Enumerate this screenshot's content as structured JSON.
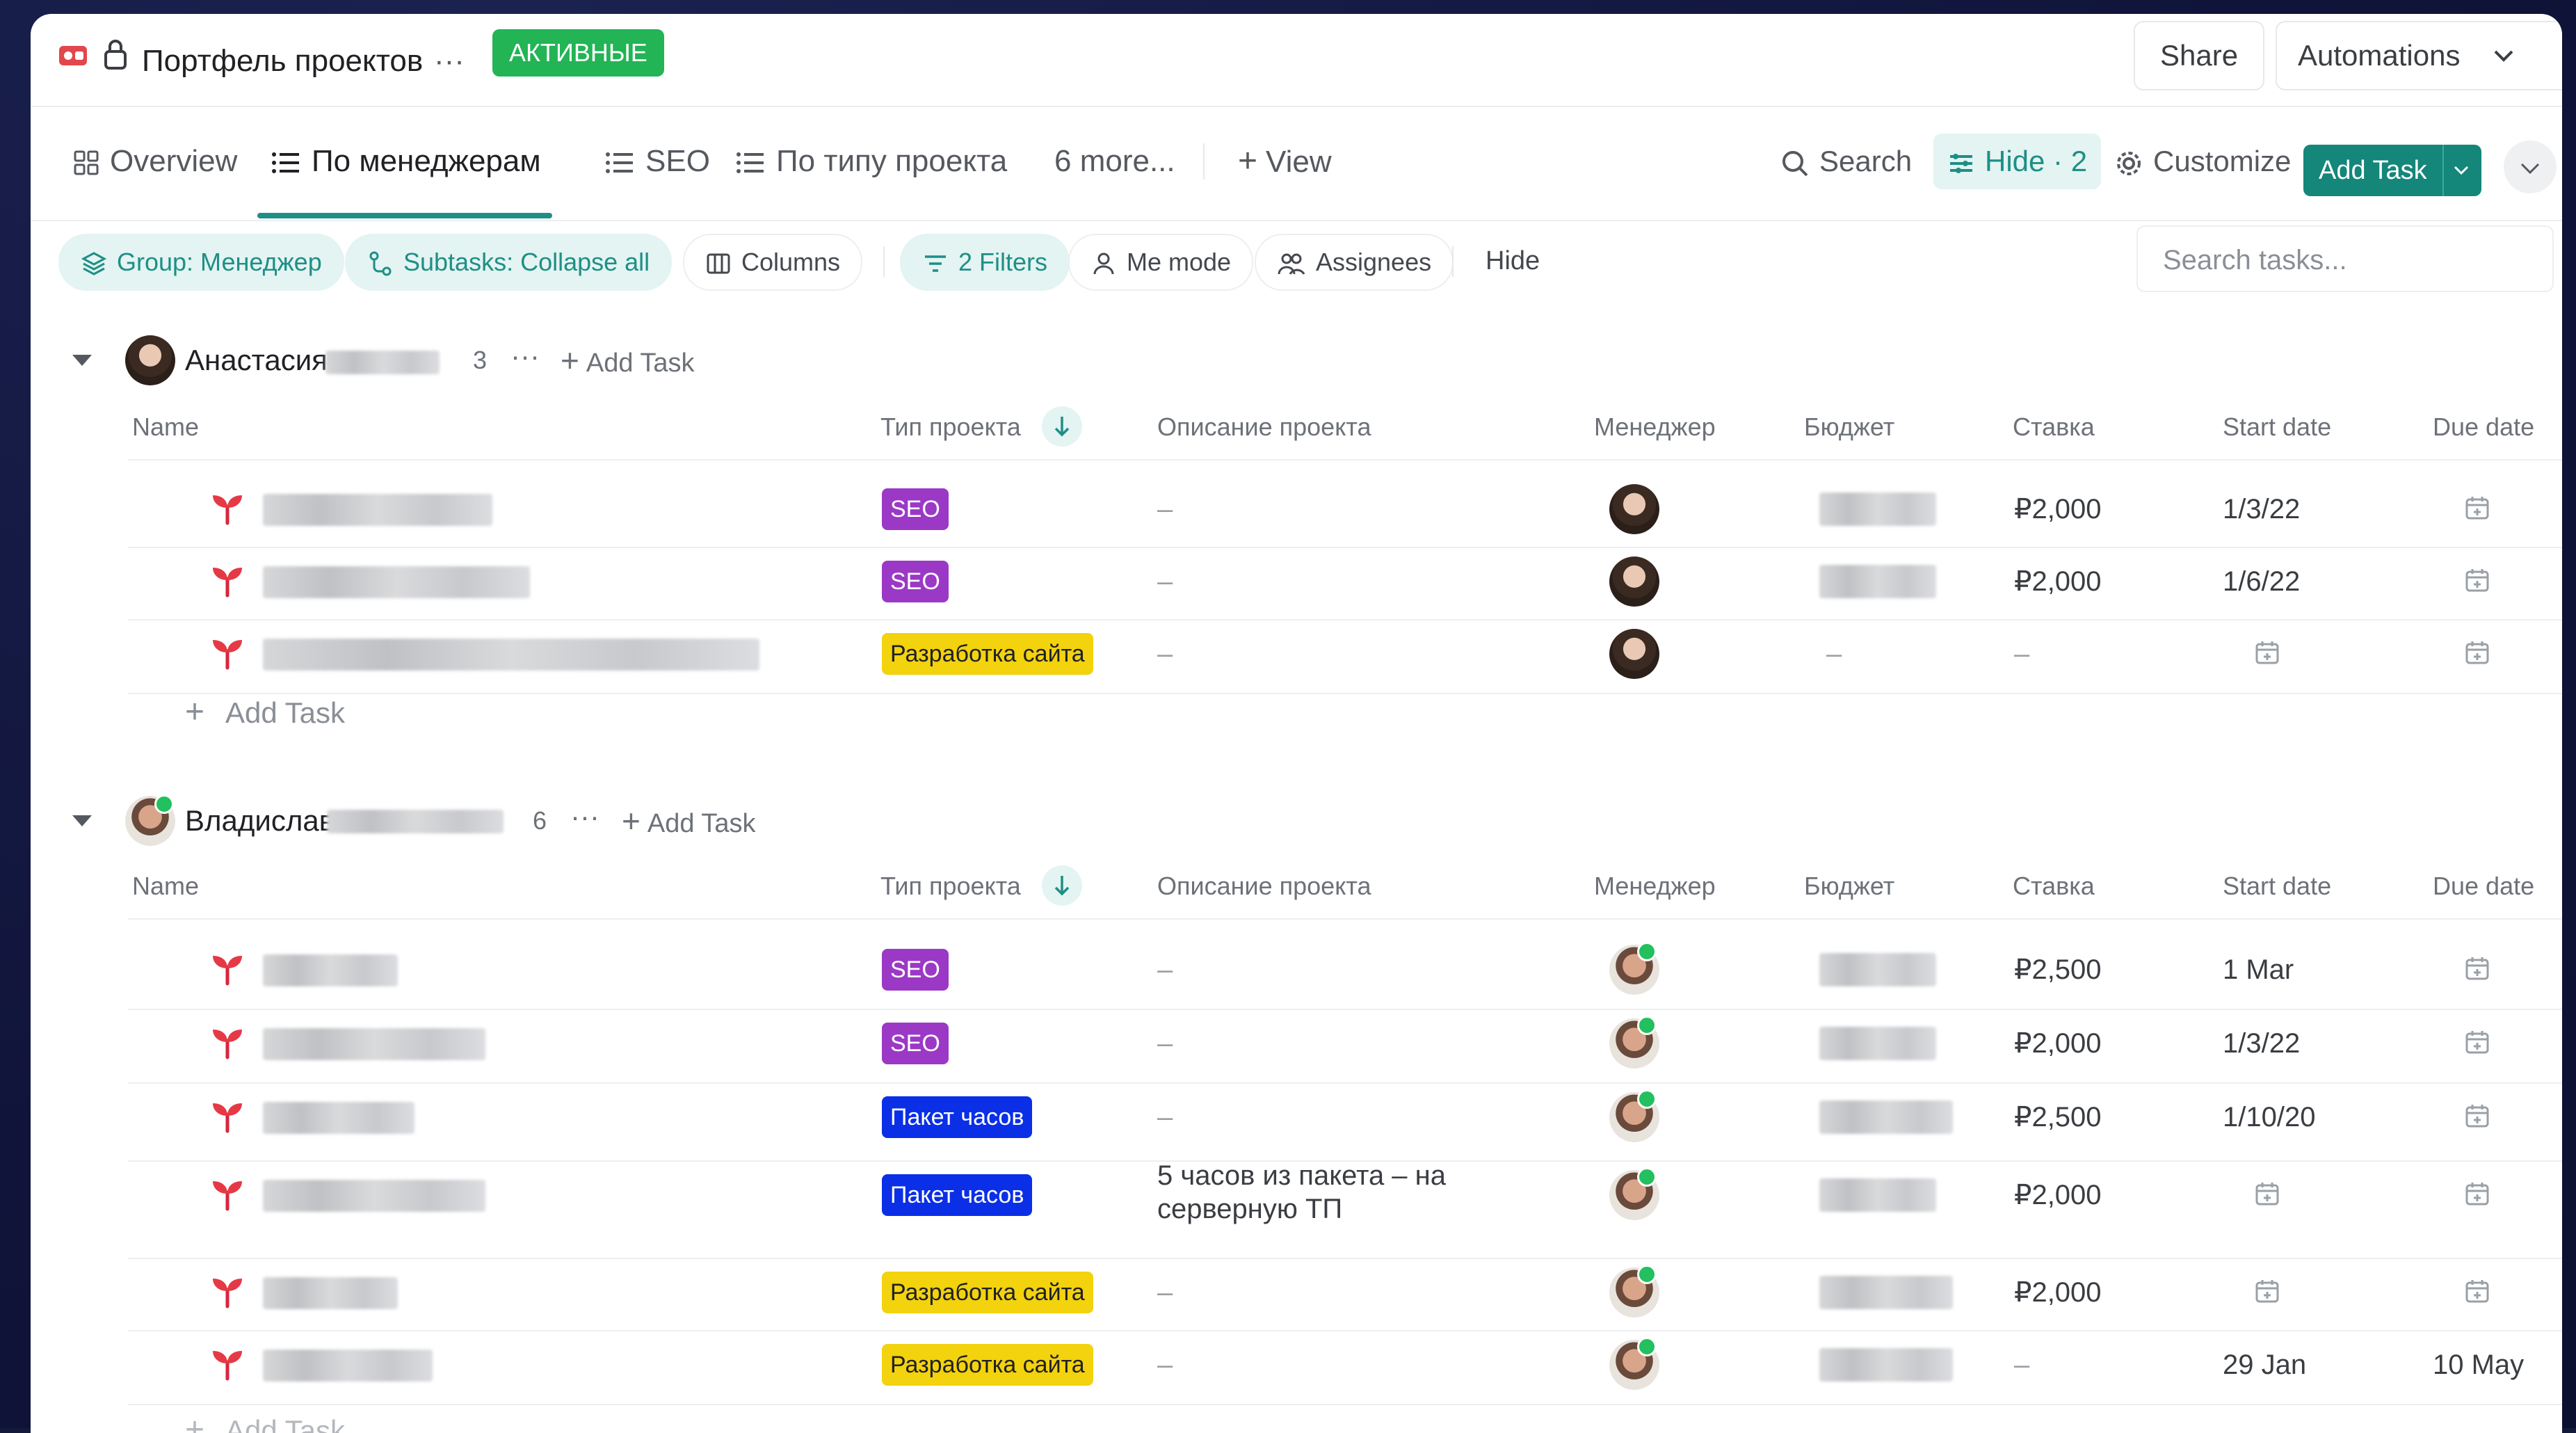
{
  "header": {
    "title": "Портфель проектов",
    "more": "···",
    "status_badge": "АКТИВНЫЕ",
    "share": "Share",
    "automations": "Automations"
  },
  "tabs": {
    "overview": "Overview",
    "by_manager": "По менеджерам",
    "seo": "SEO",
    "by_type": "По типу проекта",
    "more": "6 more...",
    "view": "View"
  },
  "toolbar": {
    "search": "Search",
    "hide": "Hide · 2",
    "customize": "Customize",
    "add_task": "Add Task"
  },
  "filters": {
    "group": "Group: Менеджер",
    "subtasks": "Subtasks: Collapse all",
    "columns": "Columns",
    "filters": "2 Filters",
    "me_mode": "Me mode",
    "assignees": "Assignees",
    "hide": "Hide",
    "search_placeholder": "Search tasks..."
  },
  "columns": {
    "name": "Name",
    "type": "Тип проекта",
    "description": "Описание проекта",
    "manager": "Менеджер",
    "budget": "Бюджет",
    "rate": "Ставка",
    "start": "Start date",
    "due": "Due date"
  },
  "groups": [
    {
      "name": "Анастасия",
      "count": "3",
      "add_task": "Add Task",
      "rows": [
        {
          "type": "SEO",
          "description": "–",
          "rate": "₽2,000",
          "start": "1/3/22",
          "due": ""
        },
        {
          "type": "SEO",
          "description": "–",
          "rate": "₽2,000",
          "start": "1/6/22",
          "due": ""
        },
        {
          "type": "Разработка сайта",
          "description": "–",
          "budget": "–",
          "rate": "–",
          "start": "",
          "due": ""
        }
      ],
      "footer_add": "Add Task"
    },
    {
      "name": "Владислав",
      "count": "6",
      "add_task": "Add Task",
      "rows": [
        {
          "type": "SEO",
          "description": "–",
          "rate": "₽2,500",
          "start": "1 Mar",
          "due": ""
        },
        {
          "type": "SEO",
          "description": "–",
          "rate": "₽2,000",
          "start": "1/3/22",
          "due": ""
        },
        {
          "type": "Пакет часов",
          "description": "–",
          "rate": "₽2,500",
          "start": "1/10/20",
          "due": ""
        },
        {
          "type": "Пакет часов",
          "description_line1": "5 часов из пакета – на",
          "description_line2": "серверную ТП",
          "rate": "₽2,000",
          "start": "",
          "due": ""
        },
        {
          "type": "Разработка сайта",
          "description": "–",
          "rate": "₽2,000",
          "start": "",
          "due": ""
        },
        {
          "type": "Разработка сайта",
          "description": "–",
          "rate": "–",
          "start": "29 Jan",
          "due": "10 May"
        }
      ],
      "footer_add": "Add Task"
    }
  ],
  "colors": {
    "accent": "#1e8f86",
    "active_badge": "#22b455",
    "seo": "#9b39c6",
    "dev": "#f3d20e",
    "hours": "#0b2fe6"
  }
}
